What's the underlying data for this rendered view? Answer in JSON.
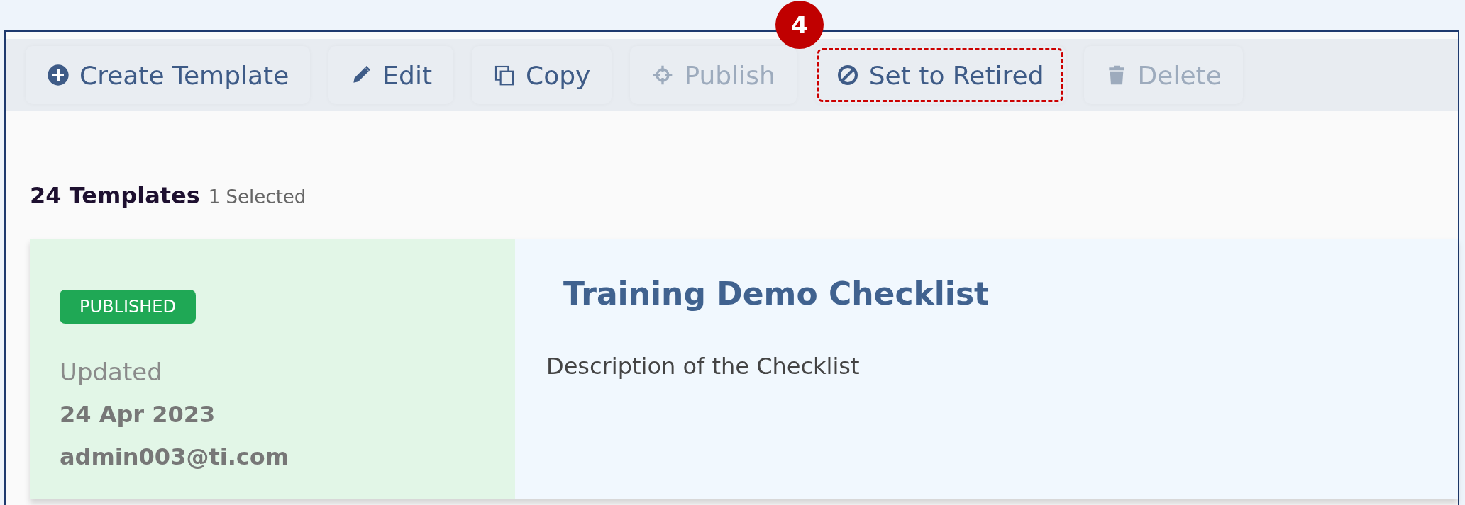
{
  "toolbar": [
    {
      "label": "Create Template",
      "kind": "create",
      "disabled": false,
      "highlighted": false
    },
    {
      "label": "Edit",
      "kind": "edit",
      "disabled": false,
      "highlighted": false
    },
    {
      "label": "Copy",
      "kind": "copy",
      "disabled": false,
      "highlighted": false
    },
    {
      "label": "Publish",
      "kind": "publish",
      "disabled": true,
      "highlighted": false
    },
    {
      "label": "Set to Retired",
      "kind": "retire",
      "disabled": false,
      "highlighted": true,
      "callout": "4"
    },
    {
      "label": "Delete",
      "kind": "delete",
      "disabled": true,
      "highlighted": false
    }
  ],
  "summary": {
    "count": "24 Templates",
    "selected": "1 Selected"
  },
  "cards": [
    {
      "status": "PUBLISHED",
      "updated_label": "Updated",
      "date": "24 Apr 2023",
      "user": "admin003@ti.com",
      "title": "Training Demo Checklist",
      "description": "Description of the Checklist"
    }
  ]
}
